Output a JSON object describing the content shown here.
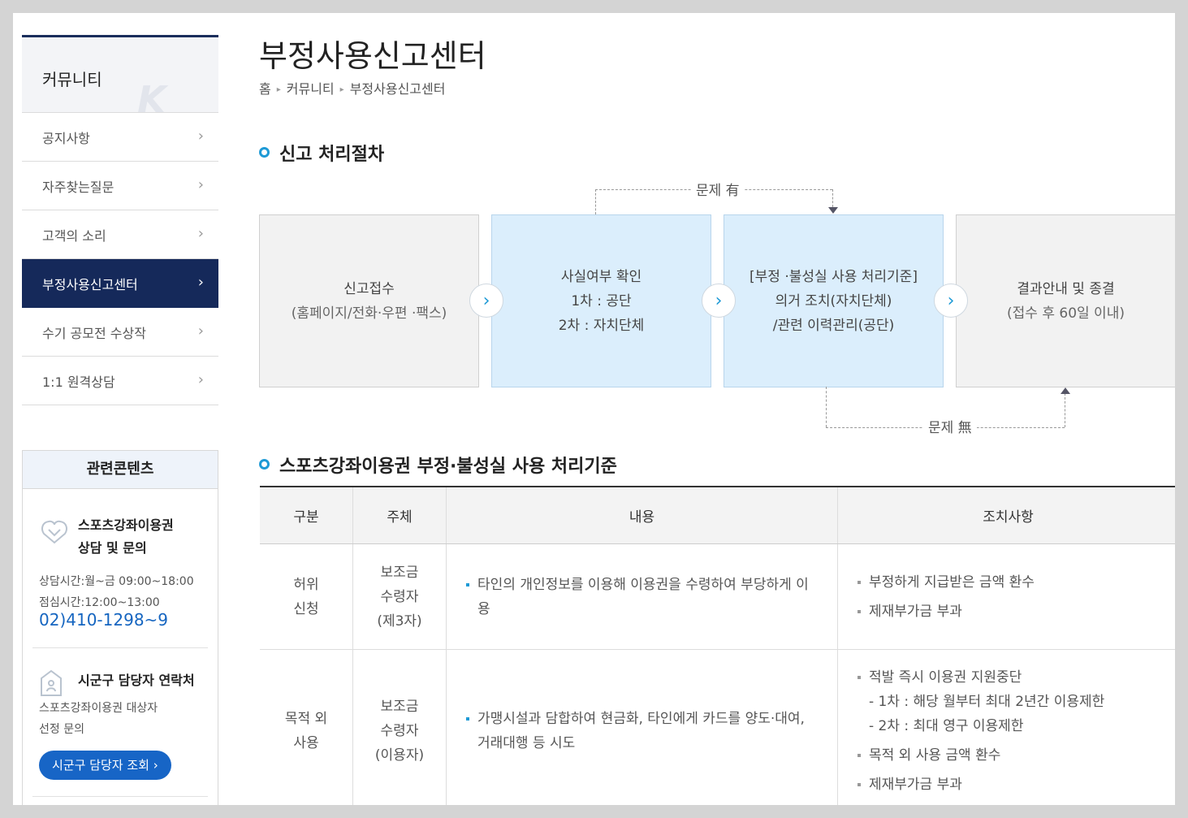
{
  "sidebar": {
    "title": "커뮤니티",
    "menu": [
      {
        "label": "공지사항"
      },
      {
        "label": "자주찾는질문"
      },
      {
        "label": "고객의 소리"
      },
      {
        "label": "부정사용신고센터"
      },
      {
        "label": "수기 공모전 수상작"
      },
      {
        "label": "1:1 원격상담"
      }
    ],
    "active_index": 3
  },
  "related": {
    "title": "관련콘텐츠",
    "box1_line1": "스포츠강좌이용권",
    "box1_line2": "상담 및 문의",
    "hours": "상담시간:월~금 09:00~18:00",
    "lunch": "점심시간:12:00~13:00",
    "phone": "02)410-1298~9",
    "box2_title": "시군구 담당자 연락처",
    "box2_line1": "스포츠강좌이용권 대상자",
    "box2_line2": "선정 문의",
    "button": "시군구 담당자 조회 ›"
  },
  "page": {
    "title": "부정사용신고센터",
    "breadcrumb": [
      "홈",
      "커뮤니티",
      "부정사용신고센터"
    ]
  },
  "flow": {
    "section_title": "신고 처리절차",
    "label_top": "문제 有",
    "label_bottom": "문제 無",
    "steps": [
      {
        "l1": "신고접수",
        "l2": "(홈페이지/전화·우편 ·팩스)",
        "l3": ""
      },
      {
        "l1": "사실여부 확인",
        "l2": "1차 : 공단",
        "l3": "2차 : 자치단체"
      },
      {
        "l1": "[부정 ·불성실 사용 처리기준]",
        "l2": "의거 조치(자치단체)",
        "l3": "/관련 이력관리(공단)"
      },
      {
        "l1": "결과안내 및 종결",
        "l2": "(접수 후 60일 이내)",
        "l3": ""
      }
    ]
  },
  "standards": {
    "section_title": "스포츠강좌이용권 부정·불성실 사용 처리기준",
    "headers": [
      "구분",
      "주체",
      "내용",
      "조치사항"
    ],
    "rows": [
      {
        "category": [
          "허위",
          "신청"
        ],
        "subject": [
          "보조금",
          "수령자",
          "(제3자)"
        ],
        "content": "타인의 개인정보를 이용해 이용권을 수령하여 부당하게 이용",
        "actions": [
          "부정하게 지급받은 금액 환수",
          "제재부가금 부과"
        ]
      },
      {
        "category": [
          "목적 외",
          "사용"
        ],
        "subject": [
          "보조금",
          "수령자",
          "(이용자)"
        ],
        "content": "가맹시설과 담합하여 현금화, 타인에게 카드를 양도·대여, 거래대행 등 시도",
        "action1": "적발 즉시 이용권 지원중단",
        "action1_sub": [
          "- 1차 : 해당 월부터 최대 2년간 이용제한",
          "- 2차 : 최대 영구 이용제한"
        ],
        "actions_more": [
          "목적 외 사용 금액 환수",
          "제재부가금 부과"
        ]
      }
    ]
  }
}
